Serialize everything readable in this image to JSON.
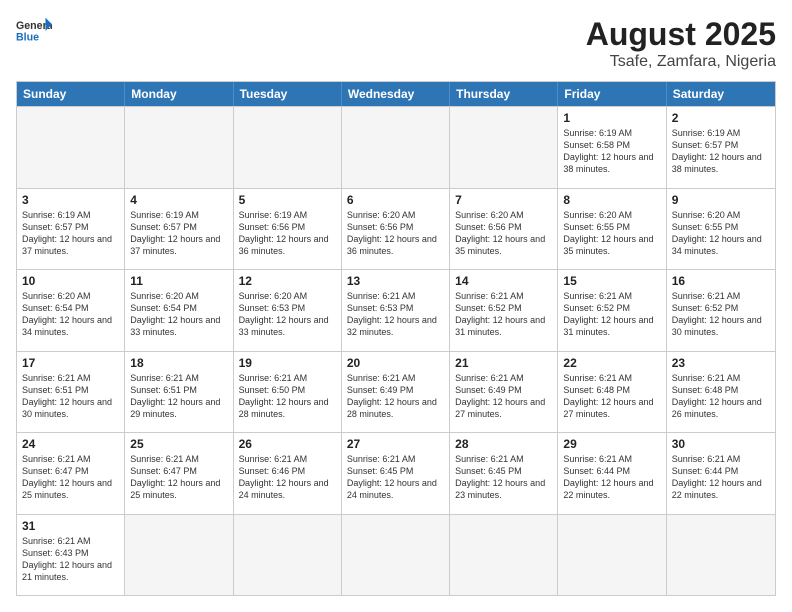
{
  "logo": {
    "text_general": "General",
    "text_blue": "Blue"
  },
  "title": "August 2025",
  "subtitle": "Tsafe, Zamfara, Nigeria",
  "days_of_week": [
    "Sunday",
    "Monday",
    "Tuesday",
    "Wednesday",
    "Thursday",
    "Friday",
    "Saturday"
  ],
  "rows": [
    [
      {
        "day": "",
        "info": ""
      },
      {
        "day": "",
        "info": ""
      },
      {
        "day": "",
        "info": ""
      },
      {
        "day": "",
        "info": ""
      },
      {
        "day": "",
        "info": ""
      },
      {
        "day": "1",
        "info": "Sunrise: 6:19 AM\nSunset: 6:58 PM\nDaylight: 12 hours and 38 minutes."
      },
      {
        "day": "2",
        "info": "Sunrise: 6:19 AM\nSunset: 6:57 PM\nDaylight: 12 hours and 38 minutes."
      }
    ],
    [
      {
        "day": "3",
        "info": "Sunrise: 6:19 AM\nSunset: 6:57 PM\nDaylight: 12 hours and 37 minutes."
      },
      {
        "day": "4",
        "info": "Sunrise: 6:19 AM\nSunset: 6:57 PM\nDaylight: 12 hours and 37 minutes."
      },
      {
        "day": "5",
        "info": "Sunrise: 6:19 AM\nSunset: 6:56 PM\nDaylight: 12 hours and 36 minutes."
      },
      {
        "day": "6",
        "info": "Sunrise: 6:20 AM\nSunset: 6:56 PM\nDaylight: 12 hours and 36 minutes."
      },
      {
        "day": "7",
        "info": "Sunrise: 6:20 AM\nSunset: 6:56 PM\nDaylight: 12 hours and 35 minutes."
      },
      {
        "day": "8",
        "info": "Sunrise: 6:20 AM\nSunset: 6:55 PM\nDaylight: 12 hours and 35 minutes."
      },
      {
        "day": "9",
        "info": "Sunrise: 6:20 AM\nSunset: 6:55 PM\nDaylight: 12 hours and 34 minutes."
      }
    ],
    [
      {
        "day": "10",
        "info": "Sunrise: 6:20 AM\nSunset: 6:54 PM\nDaylight: 12 hours and 34 minutes."
      },
      {
        "day": "11",
        "info": "Sunrise: 6:20 AM\nSunset: 6:54 PM\nDaylight: 12 hours and 33 minutes."
      },
      {
        "day": "12",
        "info": "Sunrise: 6:20 AM\nSunset: 6:53 PM\nDaylight: 12 hours and 33 minutes."
      },
      {
        "day": "13",
        "info": "Sunrise: 6:21 AM\nSunset: 6:53 PM\nDaylight: 12 hours and 32 minutes."
      },
      {
        "day": "14",
        "info": "Sunrise: 6:21 AM\nSunset: 6:52 PM\nDaylight: 12 hours and 31 minutes."
      },
      {
        "day": "15",
        "info": "Sunrise: 6:21 AM\nSunset: 6:52 PM\nDaylight: 12 hours and 31 minutes."
      },
      {
        "day": "16",
        "info": "Sunrise: 6:21 AM\nSunset: 6:52 PM\nDaylight: 12 hours and 30 minutes."
      }
    ],
    [
      {
        "day": "17",
        "info": "Sunrise: 6:21 AM\nSunset: 6:51 PM\nDaylight: 12 hours and 30 minutes."
      },
      {
        "day": "18",
        "info": "Sunrise: 6:21 AM\nSunset: 6:51 PM\nDaylight: 12 hours and 29 minutes."
      },
      {
        "day": "19",
        "info": "Sunrise: 6:21 AM\nSunset: 6:50 PM\nDaylight: 12 hours and 28 minutes."
      },
      {
        "day": "20",
        "info": "Sunrise: 6:21 AM\nSunset: 6:49 PM\nDaylight: 12 hours and 28 minutes."
      },
      {
        "day": "21",
        "info": "Sunrise: 6:21 AM\nSunset: 6:49 PM\nDaylight: 12 hours and 27 minutes."
      },
      {
        "day": "22",
        "info": "Sunrise: 6:21 AM\nSunset: 6:48 PM\nDaylight: 12 hours and 27 minutes."
      },
      {
        "day": "23",
        "info": "Sunrise: 6:21 AM\nSunset: 6:48 PM\nDaylight: 12 hours and 26 minutes."
      }
    ],
    [
      {
        "day": "24",
        "info": "Sunrise: 6:21 AM\nSunset: 6:47 PM\nDaylight: 12 hours and 25 minutes."
      },
      {
        "day": "25",
        "info": "Sunrise: 6:21 AM\nSunset: 6:47 PM\nDaylight: 12 hours and 25 minutes."
      },
      {
        "day": "26",
        "info": "Sunrise: 6:21 AM\nSunset: 6:46 PM\nDaylight: 12 hours and 24 minutes."
      },
      {
        "day": "27",
        "info": "Sunrise: 6:21 AM\nSunset: 6:45 PM\nDaylight: 12 hours and 24 minutes."
      },
      {
        "day": "28",
        "info": "Sunrise: 6:21 AM\nSunset: 6:45 PM\nDaylight: 12 hours and 23 minutes."
      },
      {
        "day": "29",
        "info": "Sunrise: 6:21 AM\nSunset: 6:44 PM\nDaylight: 12 hours and 22 minutes."
      },
      {
        "day": "30",
        "info": "Sunrise: 6:21 AM\nSunset: 6:44 PM\nDaylight: 12 hours and 22 minutes."
      }
    ],
    [
      {
        "day": "31",
        "info": "Sunrise: 6:21 AM\nSunset: 6:43 PM\nDaylight: 12 hours and 21 minutes."
      },
      {
        "day": "",
        "info": ""
      },
      {
        "day": "",
        "info": ""
      },
      {
        "day": "",
        "info": ""
      },
      {
        "day": "",
        "info": ""
      },
      {
        "day": "",
        "info": ""
      },
      {
        "day": "",
        "info": ""
      }
    ]
  ]
}
